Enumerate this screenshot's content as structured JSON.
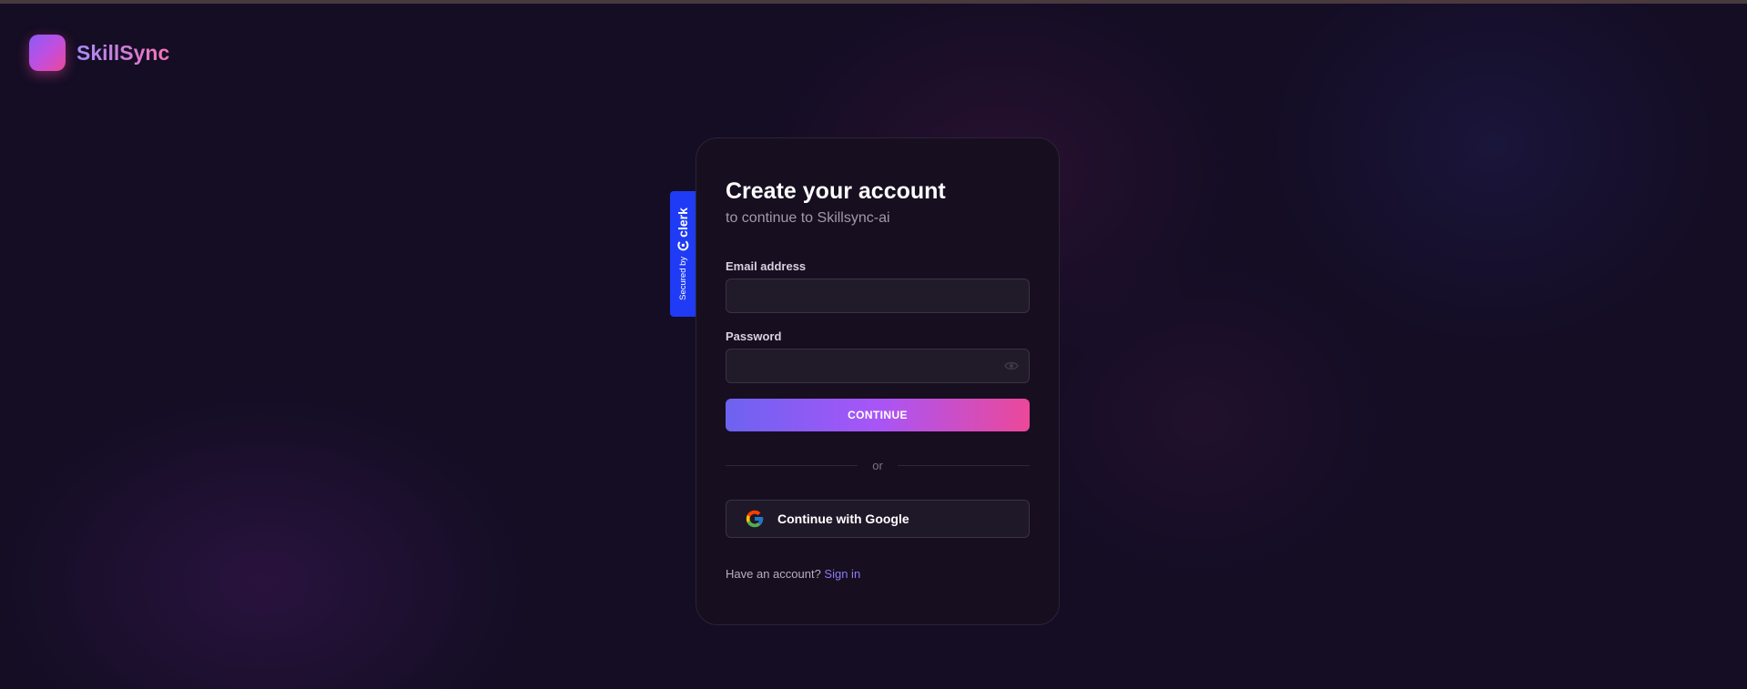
{
  "app": {
    "name": "SkillSync"
  },
  "clerk_badge": {
    "secured_by": "Secured by",
    "brand": "clerk"
  },
  "card": {
    "title": "Create your account",
    "subtitle": "to continue to Skillsync-ai",
    "email": {
      "label": "Email address",
      "value": "",
      "placeholder": ""
    },
    "password": {
      "label": "Password",
      "value": "",
      "placeholder": "",
      "toggle_icon": "eye-icon"
    },
    "continue_label": "CONTINUE",
    "divider_text": "or",
    "google": {
      "label": "Continue with Google",
      "icon": "google-icon"
    },
    "footer": {
      "prompt": "Have an account?",
      "link": "Sign in"
    }
  },
  "colors": {
    "background": "#140d24",
    "card": "#170e1f",
    "accent_start": "#6d63f1",
    "accent_mid": "#a855f7",
    "accent_end": "#ec4899",
    "clerk_blue": "#1f3bf5",
    "link": "#8b7cf6"
  }
}
